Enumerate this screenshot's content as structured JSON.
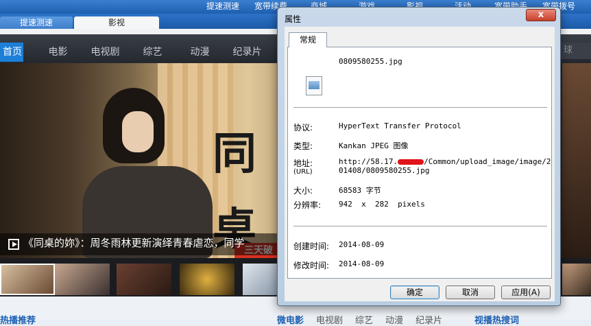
{
  "site": {
    "top_links": [
      "提速测速",
      "宽带续费",
      "商城",
      "游戏",
      "影视",
      "活动",
      "宽带助手",
      "宽带拨号"
    ],
    "tabs": [
      "提速测速",
      "影视"
    ],
    "nav": {
      "home": "首页",
      "items": [
        "电影",
        "电视剧",
        "综艺",
        "动漫",
        "纪录片"
      ],
      "search": "球"
    },
    "hero": {
      "sign_text": "同桌",
      "red_label": "三天破"
    },
    "caption": "《同桌的妳》：周冬雨林更新演绎青春虐恋，同学",
    "bottom": {
      "left": "热播推荐",
      "cats": [
        "微电影",
        "电视剧",
        "综艺",
        "动漫",
        "纪录片"
      ],
      "right": "视播热搜词"
    }
  },
  "dialog": {
    "title": "属性",
    "close": "x",
    "tab": "常规",
    "filename": "0809580255.jpg",
    "protocol_label": "协议:",
    "protocol": "HyperText Transfer Protocol",
    "type_label": "类型:",
    "type": "Kankan JPEG 图像",
    "address_label": "地址:",
    "address_sub": "(URL)",
    "address_line1_pre": "http://58.17.",
    "address_line1_post": "/Common/upload_image/image/2",
    "address_line2": "01408/0809580255.jpg",
    "size_label": "大小:",
    "size": "68583 字节",
    "resolution_label": "分辨率:",
    "resolution": "942  x  282  pixels",
    "created_label": "创建时间:",
    "created": "2014-08-09",
    "modified_label": "修改时间:",
    "modified": "2014-08-09",
    "buttons": {
      "ok": "确定",
      "cancel": "取消",
      "apply": "应用(A)"
    }
  }
}
